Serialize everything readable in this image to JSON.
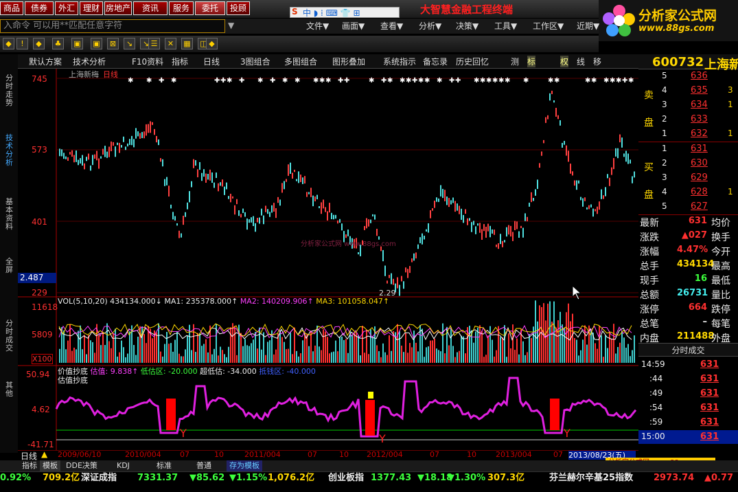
{
  "top_buttons": [
    "商品",
    "债券",
    "外汇",
    "理财",
    "房地产",
    "资讯",
    "服务",
    "委托",
    "投顾"
  ],
  "brand_title": "大智慧金融工程终端",
  "logo": {
    "line1": "分析家公式网",
    "line2": "www.88gs.com"
  },
  "cmd_placeholder": "入命令  可以用**匹配任意字符",
  "menus": [
    "文件▼",
    "画面▼",
    "查看▼",
    "分析▼",
    "决策▼",
    "工具▼",
    "工作区▼",
    "近期▼"
  ],
  "tabs": [
    "默认方案",
    "技术分析",
    "F10资料",
    "指标",
    "日线",
    "3图组合",
    "多图组合",
    "图形叠加",
    "系统指示",
    "备忘录",
    "历史回忆",
    "测",
    "标",
    "权",
    "线",
    "移"
  ],
  "side_tabs": [
    "分时走势",
    "技术分析",
    "基本资料",
    "全屏",
    "分时成交",
    "其他"
  ],
  "stock": {
    "code": "600732",
    "name": "上海新梅"
  },
  "chart": {
    "title": "上海新梅",
    "period": "日线",
    "y_labels": [
      "745",
      "573",
      "401",
      "229"
    ],
    "low_label": "2.29",
    "price_box": "2.487",
    "vol_header": {
      "vol": "VOL(5,10,20) 434134.000↓",
      "ma1": "MA1: 235378.000↑",
      "ma2": "MA2: 140209.906↑",
      "ma3": "MA3: 101058.047↑"
    },
    "vol_labels": [
      "11618",
      "5809",
      "X100"
    ],
    "ind_header": {
      "name": "价值抄底",
      "v1": "估值: 9.838↑",
      "v2": "低估区: -20.000",
      "v3": "超低估: -34.000",
      "v4": "抵钱区: -40.000"
    },
    "ind_sub": "估值抄底",
    "ind_labels": [
      "50.94",
      "4.62",
      "-41.71"
    ],
    "dates": [
      "2009/06/10",
      "2010/004",
      "07",
      "10",
      "2011/004",
      "07",
      "10",
      "2012/004",
      "07",
      "10",
      "2013/004",
      "07"
    ],
    "date_box": "2013/08/23(五)",
    "period_label": "日线"
  },
  "watermark": "分析家公式网 www.88gs.com",
  "orderbook": {
    "sell_label": [
      "卖",
      "盘"
    ],
    "buy_label": [
      "买",
      "盘"
    ],
    "sell": [
      [
        "5",
        "636",
        ""
      ],
      [
        "4",
        "635",
        "3"
      ],
      [
        "3",
        "634",
        "1"
      ],
      [
        "2",
        "633",
        ""
      ],
      [
        "1",
        "632",
        "1"
      ]
    ],
    "buy": [
      [
        "1",
        "631",
        ""
      ],
      [
        "2",
        "630",
        ""
      ],
      [
        "3",
        "629",
        ""
      ],
      [
        "4",
        "628",
        "1"
      ],
      [
        "5",
        "627",
        ""
      ]
    ]
  },
  "quote": [
    [
      "最新",
      "631",
      "均价"
    ],
    [
      "涨跌",
      "▲027",
      "换手"
    ],
    [
      "涨幅",
      "4.47%",
      "今开"
    ],
    [
      "总手",
      "434134",
      "最高"
    ],
    [
      "现手",
      "16",
      "最低"
    ],
    [
      "总额",
      "26731",
      "量比"
    ],
    [
      "涨停",
      "664",
      "跌停"
    ],
    [
      "总笔",
      "–",
      "每笔"
    ],
    [
      "内盘",
      "211488",
      "外盘"
    ]
  ],
  "trades_title": "分时成交",
  "trades": [
    [
      "14:59",
      "631"
    ],
    [
      ":44",
      "631"
    ],
    [
      ":49",
      "631"
    ],
    [
      ":54",
      "631"
    ],
    [
      ":59",
      "631"
    ],
    [
      "15:00",
      "631"
    ]
  ],
  "bottom_tabs": [
    "指标",
    "模板",
    "DDE决策",
    "KDJ",
    "标准",
    "普通",
    "存为模板"
  ],
  "status": [
    {
      "t": "0.92%",
      "c": "green"
    },
    {
      "t": "709.2亿",
      "c": "yel"
    },
    {
      "t": "深证成指",
      "c": "wht"
    },
    {
      "t": "7331.37",
      "c": "green"
    },
    {
      "t": "▼85.62",
      "c": "green"
    },
    {
      "t": "▼1.15%",
      "c": "green"
    },
    {
      "t": "1,076.2亿",
      "c": "yel"
    },
    {
      "t": "创业板指",
      "c": "wht"
    },
    {
      "t": "1377.43",
      "c": "green"
    },
    {
      "t": "▼18.18",
      "c": "green"
    },
    {
      "t": "▼1.30%",
      "c": "green"
    },
    {
      "t": "307.3亿",
      "c": "yel"
    },
    {
      "t": "芬兰赫尔辛基25指数",
      "c": "wht"
    },
    {
      "t": "2973.74",
      "c": "red"
    },
    {
      "t": "▲0.77",
      "c": "red"
    }
  ]
}
